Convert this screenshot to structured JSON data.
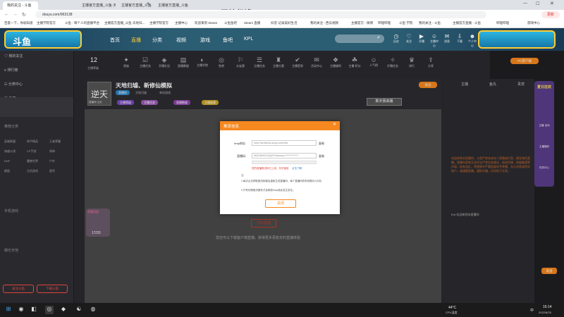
{
  "browser": {
    "tabs": [
      "我的关注 - 斗鱼",
      "主播官方直播_斗鱼·天地归墟_游...",
      "主播官方直播_斗鱼·天地归...",
      "主播官方直播_斗鱼·天地归..."
    ],
    "url": "douyu.com/963138",
    "overlay_title": "天地归墟  Steam",
    "update_label": "更新",
    "bookmarks": [
      "百度一下，你就知道",
      "主播学院官方",
      "斗鱼 - 每个人的直播平台",
      "主播官方直播_斗鱼·天地归...",
      "主播学院官方",
      "主播中心",
      "欢迎来到 Steam",
      "斗鱼鱼吧",
      "Steam 直播",
      "抖音·记录美好生活",
      "我的关注 - 西瓜视频",
      "主播官方 - 微博",
      "哔哩哔哩",
      "斗鱼 学院",
      "我的关注 - 斗鱼",
      "主播官方直播 - 斗鱼",
      "哔哩哔哩",
      "游戏中心"
    ]
  },
  "header": {
    "logo_text": "斗鱼",
    "nav": [
      "首页",
      "直播",
      "分类",
      "视频",
      "游戏",
      "鱼吧",
      "KPL"
    ],
    "icons": [
      {
        "name": "history-icon",
        "label": "历史"
      },
      {
        "name": "follow-icon",
        "label": "关注"
      },
      {
        "name": "broadcast-icon",
        "label": "开播"
      },
      {
        "name": "anchor-icon",
        "label": "主播中心"
      },
      {
        "name": "message-icon",
        "label": "消息"
      },
      {
        "name": "download-icon",
        "label": "下载"
      },
      {
        "name": "user-center-icon",
        "label": "个人中心"
      }
    ]
  },
  "sidebar": {
    "items": [
      "我的关注",
      "排行榜",
      "分类中心",
      "鱼吧",
      "赛事"
    ],
    "section_recommend": "推荐分类",
    "hot_games": [
      "英雄联盟",
      "和平精英",
      "王者荣耀",
      "穿越火线",
      "CF手游",
      "原神",
      "DNF",
      "魔兽世界",
      "户外",
      "颜值",
      "主机游戏",
      "星秀"
    ],
    "section_mobile": "手机游戏",
    "section_entertainment": "娱乐天地",
    "follow_button": "关注斗鱼",
    "download_button": "下载斗鱼"
  },
  "category_bar": {
    "left_count": "12",
    "left_label": "主播等级",
    "items": [
      "贵族",
      "主播任务",
      "开播礼包",
      "直播数据",
      "主播学院",
      "鱼吧",
      "水友赛",
      "主播任务",
      "主播大赛",
      "主播签到",
      "活动中心",
      "主播福利",
      "主播·积分",
      "人气榜",
      "开播任务",
      "排行",
      "分享"
    ]
  },
  "streamer": {
    "avatar_text": "逆天",
    "avatar_caption": "直播间·主页",
    "title": "天地归墟、新修仙模拟",
    "tags": [
      "直播间",
      "天地归墟",
      "单机游戏"
    ],
    "badges": [
      "主播等级",
      "主播任务",
      "直播数据",
      "主播勋章"
    ],
    "btn_right": "关注",
    "ticket": "数天我来播"
  },
  "modal": {
    "title": "推流信息",
    "rtmp_label": "rtmp地址:",
    "rtmp_value": "rtmp://sendtc3a.douyu.com/live",
    "code_label": "直播码:",
    "code_value": "963138r9CXiGpDFhxlavaov=*************",
    "copy_label": "复制",
    "warning": "您的直播推流码已上线，仅可使用",
    "warning_link": "点击了解",
    "notes_title": "注:",
    "notes": [
      "1.每次点击获取推流码都会重新生成直播码，每个直播码的有效期为1分钟。",
      "2.只有切换推流服务才会释放rtmp地址发生变化。"
    ],
    "ok_button": "关闭"
  },
  "video": {
    "start_button": "开始直播",
    "hint": "您还可以下载客户端直播，获得更多更稳定的直播体验",
    "thumb_caption": "直播回放",
    "thumb_count": "17/20"
  },
  "right_panel": {
    "tabs": [
      "主播",
      "鱼丸",
      "贵宾"
    ],
    "pc_badge": "PC客户端",
    "chat_notice": "欢迎来到本直播间，斗鱼严禁未成年人直播或打赏，倡导绿色直播。直播内容和互动评论严禁包含政治、低俗色情、吸烟酗酒等内容，若有违反，将视情节严重程度给予禁播、永久封禁或停封账户，请谨慎直播。谨防诈骗，切勿私下交易。",
    "chat_user": "Ewi 欢迎来到本直播间",
    "send_label": "发送"
  },
  "promo": {
    "title": "夏日狂欢",
    "items": [
      "主播·活动",
      "主播福利",
      "任务中心"
    ]
  },
  "taskbar": {
    "temp": "44°C",
    "cpu": "CPU温度",
    "time": "16:14",
    "date": "2022/8/25",
    "lang": "中"
  },
  "colors": {
    "accent": "#f5881f",
    "header_bg": "#2b5d73",
    "sidebar_bg": "#2a2a2e",
    "modal_head": "#f5881f"
  }
}
